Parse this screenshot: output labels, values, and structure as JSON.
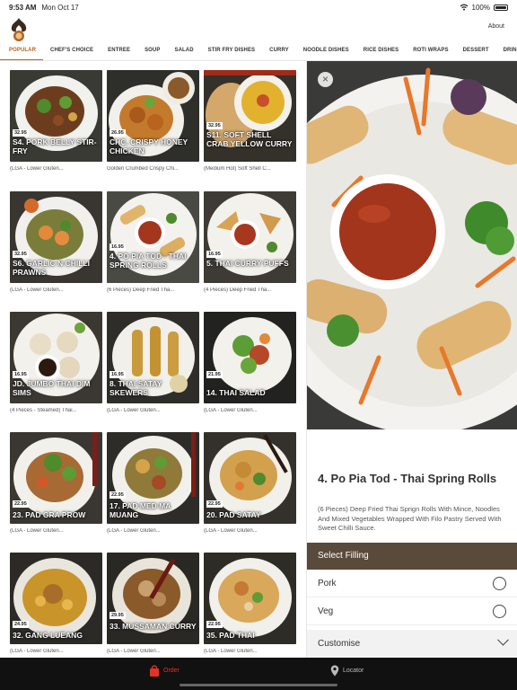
{
  "status": {
    "time": "9:53 AM",
    "date": "Mon Oct 17",
    "battery": "100%"
  },
  "header": {
    "about": "About"
  },
  "tabs": [
    "POPULAR",
    "CHEF'S CHOICE",
    "ENTREE",
    "SOUP",
    "SALAD",
    "STIR FRY DISHES",
    "CURRY",
    "NOODLE DISHES",
    "RICE DISHES",
    "ROTI WRAPS",
    "DESSERT",
    "DRINKS"
  ],
  "menu": [
    {
      "price": "32.95",
      "name": "S4. PORK BELLY STIR-FRY",
      "desc": "(LGA - Lower Gluten..."
    },
    {
      "price": "26.95",
      "name": "CHC. CRISPY HONEY CHICKEN",
      "desc": "Golden Crumbed Crispy Chi..."
    },
    {
      "price": "32.95",
      "name": "S11. SOFT SHELL CRAB YELLOW CURRY",
      "desc": "(Medium Hot) Soft Shell C..."
    },
    {
      "price": "32.95",
      "name": "S6. GARLIC N CHILLI PRAWNS",
      "desc": "(LGA - Lower Gluten..."
    },
    {
      "price": "16.95",
      "name": "4. PO PIA TOD - THAI SPRING ROLLS",
      "desc": "(6 Pieces) Deep Fried Tha..."
    },
    {
      "price": "16.95",
      "name": "5. THAI CURRY PUFFS",
      "desc": "(4 Pieces) Deep Fried Tha..."
    },
    {
      "price": "16.95",
      "name": "JD. JUMBO THAI DIM SIMS",
      "desc": "(4 Pieces - Steamed) Thai..."
    },
    {
      "price": "16.95",
      "name": "8. THAI SATAY SKEWERS",
      "desc": "(LGA - Lower Gluten..."
    },
    {
      "price": "21.95",
      "name": "14. THAI SALAD",
      "desc": "(LGA - Lower Gluten..."
    },
    {
      "price": "22.95",
      "name": "23. PAD GRA PROW",
      "desc": "(LGA - Lower Gluten..."
    },
    {
      "price": "22.95",
      "name": "17. PAD MED MA MUANG",
      "desc": "(LGA - Lower Gluten..."
    },
    {
      "price": "22.95",
      "name": "20. PAD SATAY",
      "desc": "(LGA - Lower Gluten..."
    },
    {
      "price": "24.95",
      "name": "32. GANG LUEANG",
      "desc": "(LGA - Lower Gluten..."
    },
    {
      "price": "29.95",
      "name": "33. MUSSAMAN CURRY",
      "desc": "(LGA - Lower Gluten..."
    },
    {
      "price": "22.95",
      "name": "35. PAD THAI",
      "desc": "(LGA - Lower Gluten..."
    }
  ],
  "detail": {
    "title": "4. Po Pia Tod - Thai Spring Rolls",
    "description": "(6 Pieces) Deep Fried Thai Sprign Rolls With Mince, Noodles And Mixed Vegetables Wrapped With Filo Pastry Served With Sweet Chilli Sauce.",
    "section": "Select Filling",
    "options": [
      "Pork",
      "Veg"
    ],
    "customise": "Customise"
  },
  "nav": {
    "order": "Order",
    "locator": "Locator"
  },
  "colors": {
    "accent": "#b5651d",
    "section_bg": "#5a4a3b",
    "order_active": "#e0342b"
  }
}
